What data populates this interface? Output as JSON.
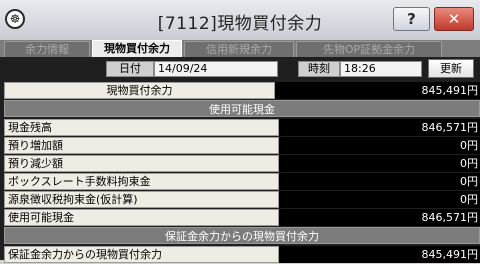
{
  "window": {
    "title": "[7112]現物買付余力",
    "app_icon_glyph": "☸",
    "help_label": "?",
    "close_label": "✕"
  },
  "tabs": [
    {
      "label": "余力情報",
      "active": false
    },
    {
      "label": "現物買付余力",
      "active": true
    },
    {
      "label": "信用新規余力",
      "active": false
    },
    {
      "label": "先物OP証拠金余力",
      "active": false
    }
  ],
  "filter": {
    "date_label": "日付",
    "date_value": "14/09/24",
    "time_label": "時刻",
    "time_value": "18:26",
    "refresh_label": "更新"
  },
  "summary": {
    "label": "現物買付余力",
    "value": "845,491円"
  },
  "section1": {
    "title": "使用可能現金",
    "rows": [
      {
        "label": "現金残高",
        "value": "846,571円"
      },
      {
        "label": "預り増加額",
        "value": "0円"
      },
      {
        "label": "預り減少額",
        "value": "0円"
      },
      {
        "label": "ボックスレート手数料拘束金",
        "value": "0円"
      },
      {
        "label": "源泉徴収税拘束金(仮計算)",
        "value": "0円"
      },
      {
        "label": "使用可能現金",
        "value": "846,571円"
      }
    ]
  },
  "section2": {
    "title": "保証金余力からの現物買付余力",
    "rows": [
      {
        "label": "保証金余力からの現物買付余力",
        "value": "845,491円"
      }
    ]
  },
  "colors": {
    "panel_bg": "#1f1f1f",
    "value_bg": "#000000",
    "label_bg": "#efece3",
    "section_bg": "#7c7c7c",
    "close_red": "#c0392b"
  }
}
